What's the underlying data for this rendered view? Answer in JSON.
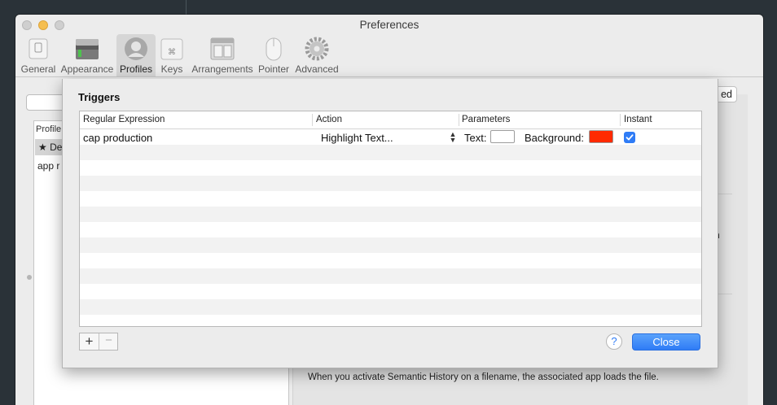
{
  "window": {
    "title": "Preferences"
  },
  "toolbar": {
    "items": [
      {
        "label": "General",
        "icon": "general-icon"
      },
      {
        "label": "Appearance",
        "icon": "appearance-icon"
      },
      {
        "label": "Profiles",
        "icon": "profiles-icon",
        "selected": true
      },
      {
        "label": "Keys",
        "icon": "keys-icon"
      },
      {
        "label": "Arrangements",
        "icon": "arrangements-icon"
      },
      {
        "label": "Pointer",
        "icon": "pointer-icon"
      },
      {
        "label": "Advanced",
        "icon": "gear-icon"
      }
    ]
  },
  "background": {
    "profile_list_header": "Profile",
    "default_row": "★ De",
    "app_row": "app r",
    "advanced_button_fragment": "ed",
    "cut_char": "n",
    "semantic_history_note": "When you activate Semantic History on a filename, the associated app loads the file."
  },
  "triggers": {
    "title": "Triggers",
    "columns": {
      "regex": "Regular Expression",
      "action": "Action",
      "parameters": "Parameters",
      "instant": "Instant"
    },
    "rows": [
      {
        "regex": "cap production",
        "action": "Highlight Text...",
        "text_label": "Text:",
        "text_color": "#ffffff",
        "background_label": "Background:",
        "background_color": "#ff2a00",
        "instant": true
      }
    ],
    "add_label": "+",
    "remove_label": "−",
    "help_label": "?",
    "close_label": "Close"
  }
}
